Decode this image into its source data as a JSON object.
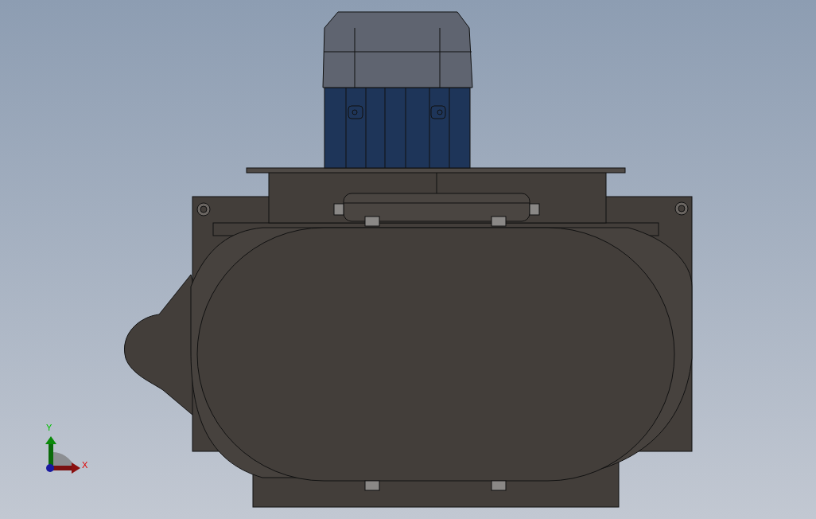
{
  "viewport": {
    "triad": {
      "axes": [
        {
          "kind": "y",
          "label": "Y"
        },
        {
          "kind": "x",
          "label": "X"
        }
      ]
    }
  }
}
